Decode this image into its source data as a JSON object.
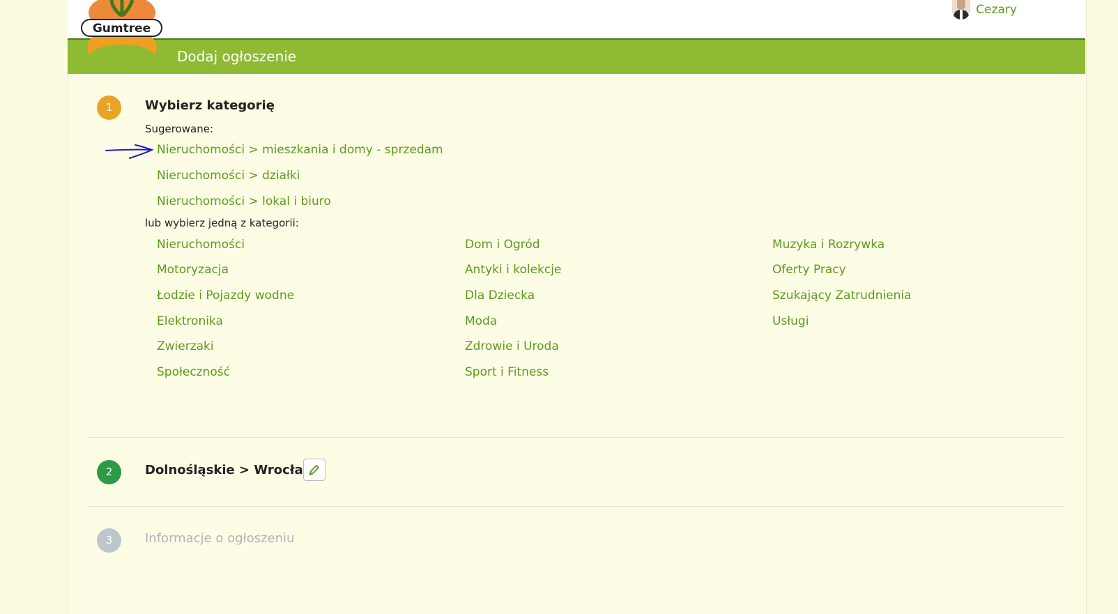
{
  "header": {
    "logo_text": "Gumtree",
    "user_name": "Cezary",
    "page_title": "Dodaj ogłoszenie"
  },
  "step1": {
    "number": "1",
    "title": "Wybierz kategorię",
    "suggested_label": "Sugerowane:",
    "suggested": [
      "Nieruchomości > mieszkania i domy - sprzedam",
      "Nieruchomości > działki",
      "Nieruchomości > lokal i biuro"
    ],
    "choose_label": "lub wybierz jedną z kategorii:",
    "columns": [
      [
        "Nieruchomości",
        "Motoryzacja",
        "Łodzie i Pojazdy wodne",
        "Elektronika",
        "Zwierzaki",
        "Społeczność"
      ],
      [
        "Dom i Ogród",
        "Antyki i kolekcje",
        "Dla Dziecka",
        "Moda",
        "Zdrowie i Uroda",
        "Sport i Fitness"
      ],
      [
        "Muzyka i Rozrywka",
        "Oferty Pracy",
        "Szukający Zatrudnienia",
        "Usługi"
      ]
    ]
  },
  "step2": {
    "number": "2",
    "title": "Dolnośląskie > Wrocław"
  },
  "step3": {
    "number": "3",
    "title": "Informacje o ogłoszeniu"
  },
  "colors": {
    "brand_green": "#8fba34",
    "link_green": "#5c9a1e",
    "step1_orange": "#e9a325",
    "step2_green": "#2e9a48",
    "step3_gray": "#bcc6cc",
    "annotation_blue": "#1a1ad0"
  },
  "icons": {
    "edit": "pencil-icon",
    "annotation": "hand-drawn-arrow-icon"
  }
}
